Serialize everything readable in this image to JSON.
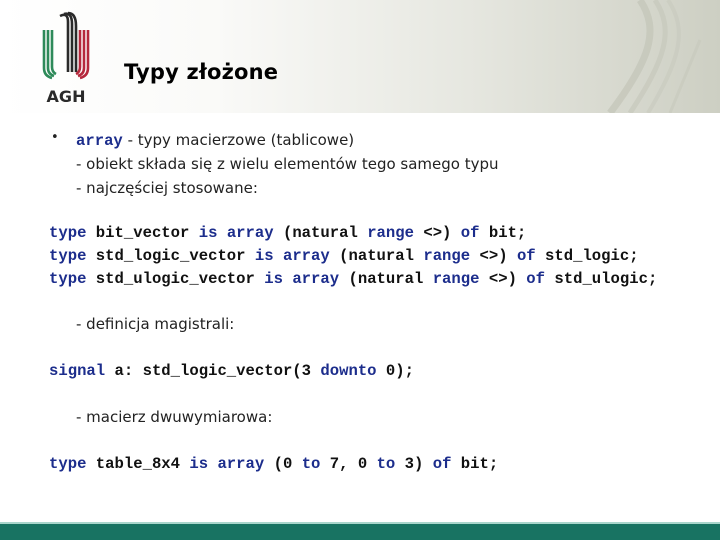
{
  "header": {
    "logo_text": "AGH",
    "title": "Typy złożone"
  },
  "bullet": {
    "symbol": "•",
    "keyword": "array",
    "text": " - typy macierzowe (tablicowe)"
  },
  "lines": [
    "- obiekt składa się z wielu elementów tego samego typu",
    "- najczęściej stosowane:"
  ],
  "code_block_1": [
    [
      {
        "t": "type",
        "k": true
      },
      {
        "t": " bit_vector ",
        "k": false
      },
      {
        "t": "is",
        "k": true
      },
      {
        "t": " ",
        "k": false
      },
      {
        "t": "array",
        "k": true
      },
      {
        "t": " (natural ",
        "k": false
      },
      {
        "t": "range",
        "k": true
      },
      {
        "t": " <>) ",
        "k": false
      },
      {
        "t": "of",
        "k": true
      },
      {
        "t": " bit;",
        "k": false
      }
    ],
    [
      {
        "t": "type",
        "k": true
      },
      {
        "t": " std_logic_vector ",
        "k": false
      },
      {
        "t": "is",
        "k": true
      },
      {
        "t": " ",
        "k": false
      },
      {
        "t": "array",
        "k": true
      },
      {
        "t": " (natural ",
        "k": false
      },
      {
        "t": "range",
        "k": true
      },
      {
        "t": " <>) ",
        "k": false
      },
      {
        "t": "of",
        "k": true
      },
      {
        "t": " std_logic;",
        "k": false
      }
    ],
    [
      {
        "t": "type",
        "k": true
      },
      {
        "t": " std_ulogic_vector ",
        "k": false
      },
      {
        "t": "is",
        "k": true
      },
      {
        "t": " ",
        "k": false
      },
      {
        "t": "array",
        "k": true
      },
      {
        "t": " (natural ",
        "k": false
      },
      {
        "t": "range",
        "k": true
      },
      {
        "t": " <>) ",
        "k": false
      },
      {
        "t": "of",
        "k": true
      },
      {
        "t": " std_ulogic;",
        "k": false
      }
    ]
  ],
  "section_bus": "- definicja magistrali:",
  "code_block_2": [
    [
      {
        "t": "signal",
        "k": true
      },
      {
        "t": " a: std_logic_vector(3 ",
        "k": false
      },
      {
        "t": "downto",
        "k": true
      },
      {
        "t": " 0);",
        "k": false
      }
    ]
  ],
  "section_2d": "- macierz dwuwymiarowa:",
  "code_block_3": [
    [
      {
        "t": "type",
        "k": true
      },
      {
        "t": " table_8x4 ",
        "k": false
      },
      {
        "t": "is",
        "k": true
      },
      {
        "t": " ",
        "k": false
      },
      {
        "t": "array",
        "k": true
      },
      {
        "t": " (0 ",
        "k": false
      },
      {
        "t": "to",
        "k": true
      },
      {
        "t": " 7, 0 ",
        "k": false
      },
      {
        "t": "to",
        "k": true
      },
      {
        "t": " 3) ",
        "k": false
      },
      {
        "t": "of",
        "k": true
      },
      {
        "t": " bit;",
        "k": false
      }
    ]
  ],
  "colors": {
    "keyword": "#1c2d8c",
    "footer": "#187362",
    "logo_green": "#2e8a5a",
    "logo_black": "#2a2a2a",
    "logo_red": "#b5283c"
  }
}
